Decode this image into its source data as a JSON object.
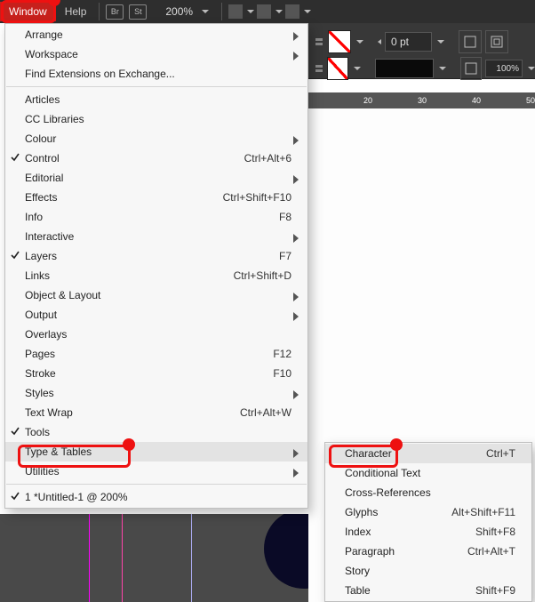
{
  "menubar": {
    "items": [
      "Window",
      "Help"
    ],
    "zoom": "200%",
    "squares": [
      "Br",
      "St"
    ]
  },
  "toolbar": {
    "pt": "0 pt",
    "pct": "100%"
  },
  "ruler": {
    "ticks": [
      "20",
      "30",
      "40",
      "50"
    ]
  },
  "windowMenu": {
    "groups": [
      [
        {
          "label": "Arrange",
          "sub": true
        },
        {
          "label": "Workspace",
          "sub": true
        },
        {
          "label": "Find Extensions on Exchange..."
        }
      ],
      [
        {
          "label": "Articles"
        },
        {
          "label": "CC Libraries"
        },
        {
          "label": "Colour",
          "sub": true
        },
        {
          "label": "Control",
          "shortcut": "Ctrl+Alt+6",
          "checked": true
        },
        {
          "label": "Editorial",
          "sub": true
        },
        {
          "label": "Effects",
          "shortcut": "Ctrl+Shift+F10"
        },
        {
          "label": "Info",
          "shortcut": "F8"
        },
        {
          "label": "Interactive",
          "sub": true
        },
        {
          "label": "Layers",
          "shortcut": "F7",
          "checked": true
        },
        {
          "label": "Links",
          "shortcut": "Ctrl+Shift+D"
        },
        {
          "label": "Object & Layout",
          "sub": true
        },
        {
          "label": "Output",
          "sub": true
        },
        {
          "label": "Overlays"
        },
        {
          "label": "Pages",
          "shortcut": "F12"
        },
        {
          "label": "Stroke",
          "shortcut": "F10"
        },
        {
          "label": "Styles",
          "sub": true
        },
        {
          "label": "Text Wrap",
          "shortcut": "Ctrl+Alt+W"
        },
        {
          "label": "Tools",
          "checked": true
        },
        {
          "label": "Type & Tables",
          "sub": true,
          "hover": true
        },
        {
          "label": "Utilities",
          "sub": true
        }
      ],
      [
        {
          "label": "1 *Untitled-1 @ 200%",
          "checked": true
        }
      ]
    ]
  },
  "subMenu": [
    {
      "label": "Character",
      "shortcut": "Ctrl+T",
      "hover": true
    },
    {
      "label": "Conditional Text"
    },
    {
      "label": "Cross-References"
    },
    {
      "label": "Glyphs",
      "shortcut": "Alt+Shift+F11"
    },
    {
      "label": "Index",
      "shortcut": "Shift+F8"
    },
    {
      "label": "Paragraph",
      "shortcut": "Ctrl+Alt+T"
    },
    {
      "label": "Story"
    },
    {
      "label": "Table",
      "shortcut": "Shift+F9"
    }
  ]
}
